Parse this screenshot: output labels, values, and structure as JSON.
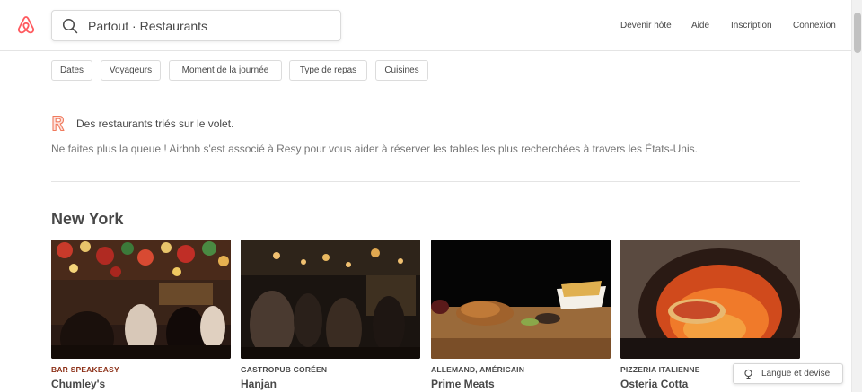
{
  "header": {
    "search_text": "Partout · Restaurants",
    "nav": {
      "host": "Devenir hôte",
      "help": "Aide",
      "signup": "Inscription",
      "login": "Connexion"
    }
  },
  "filters": {
    "dates": "Dates",
    "guests": "Voyageurs",
    "time_of_day": "Moment de la journée",
    "meal_type": "Type de repas",
    "cuisines": "Cuisines"
  },
  "promo": {
    "title": "Des restaurants triés sur le volet.",
    "description": "Ne faites plus la queue ! Airbnb s'est associé à Resy pour vous aider à réserver les tables les plus recherchées à travers les États-Unis."
  },
  "section": {
    "title": "New York"
  },
  "cards": [
    {
      "category": "BAR SPEAKEASY",
      "name": "Chumley's",
      "category_color": "#8c2f16"
    },
    {
      "category": "GASTROPUB CORÉEN",
      "name": "Hanjan",
      "category_color": "#484848"
    },
    {
      "category": "ALLEMAND, AMÉRICAIN",
      "name": "Prime Meats",
      "category_color": "#484848"
    },
    {
      "category": "PIZZERIA ITALIENNE",
      "name": "Osteria Cotta",
      "category_color": "#484848"
    }
  ],
  "footer_button": {
    "label": "Langue et devise"
  },
  "colors": {
    "brand": "#ff5a5f",
    "text": "#484848",
    "muted": "#767676"
  }
}
